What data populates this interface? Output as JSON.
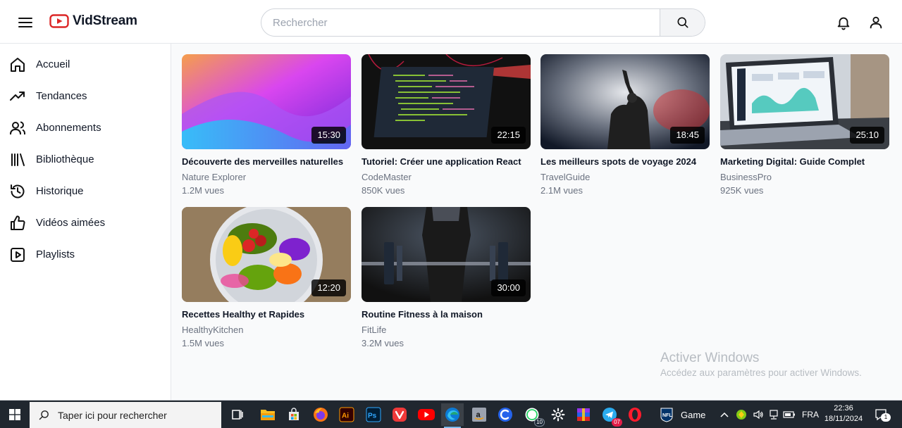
{
  "header": {
    "logo_text": "VidStream",
    "search_placeholder": "Rechercher"
  },
  "sidebar": {
    "items": [
      {
        "label": "Accueil",
        "icon": "home-icon"
      },
      {
        "label": "Tendances",
        "icon": "trending-icon"
      },
      {
        "label": "Abonnements",
        "icon": "users-icon"
      },
      {
        "label": "Bibliothèque",
        "icon": "library-icon"
      },
      {
        "label": "Historique",
        "icon": "history-icon"
      },
      {
        "label": "Vidéos aimées",
        "icon": "thumbs-up-icon"
      },
      {
        "label": "Playlists",
        "icon": "playlist-icon"
      }
    ]
  },
  "videos": [
    {
      "title": "Découverte des merveilles naturelles",
      "channel": "Nature Explorer",
      "views": "1.2M vues",
      "duration": "15:30"
    },
    {
      "title": "Tutoriel: Créer une application React",
      "channel": "CodeMaster",
      "views": "850K vues",
      "duration": "22:15"
    },
    {
      "title": "Les meilleurs spots de voyage 2024",
      "channel": "TravelGuide",
      "views": "2.1M vues",
      "duration": "18:45"
    },
    {
      "title": "Marketing Digital: Guide Complet",
      "channel": "BusinessPro",
      "views": "925K vues",
      "duration": "25:10"
    },
    {
      "title": "Recettes Healthy et Rapides",
      "channel": "HealthyKitchen",
      "views": "1.5M vues",
      "duration": "12:20"
    },
    {
      "title": "Routine Fitness à la maison",
      "channel": "FitLife",
      "views": "3.2M vues",
      "duration": "30:00"
    }
  ],
  "watermark": {
    "title": "Activer Windows",
    "subtitle": "Accédez aux paramètres pour activer Windows."
  },
  "taskbar": {
    "search_placeholder": "Taper ici pour rechercher",
    "apps": [
      "task-view-icon",
      "file-explorer-icon",
      "store-icon",
      "firefox-icon",
      "illustrator-icon",
      "photoshop-icon",
      "vivaldi-icon",
      "youtube-icon",
      "edge-icon",
      "amazon-icon",
      "ccleaner-icon",
      "whatsapp-icon",
      "settings-icon",
      "winrar-icon",
      "telegram-icon",
      "opera-icon",
      "nfl-icon"
    ],
    "whatsapp_badge": "10",
    "telegram_badge": "07",
    "game_label": "Game",
    "language": "FRA",
    "time": "22:36",
    "date": "18/11/2024",
    "notification_count": "1"
  },
  "colors": {
    "accent_red": "#dc2626",
    "sidebar_bg": "#ffffff",
    "content_bg": "#f9fafb",
    "taskbar_bg": "#20272f"
  }
}
